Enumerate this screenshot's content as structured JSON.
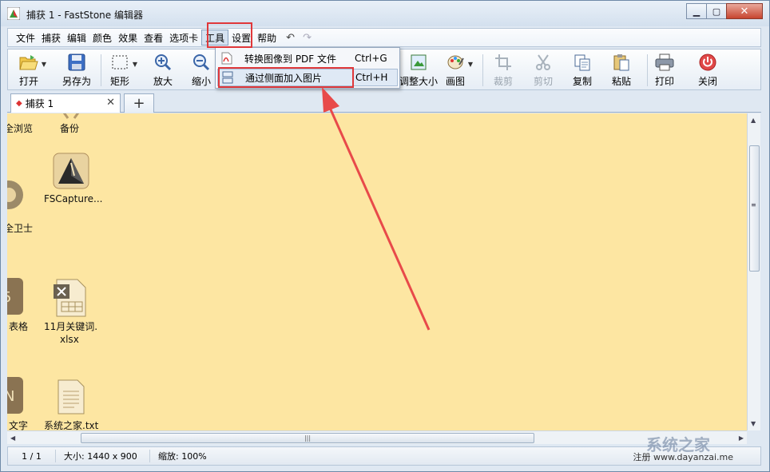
{
  "window": {
    "title": "捕获 1 - FastStone 编辑器",
    "controls": {
      "minimize": "▁",
      "maximize": "▢",
      "close": "✕"
    }
  },
  "menu": {
    "items": [
      "文件",
      "捕获",
      "编辑",
      "颜色",
      "效果",
      "查看",
      "选项卡",
      "工具",
      "设置",
      "帮助"
    ],
    "active": "工具",
    "undo": "↶",
    "redo": "↷"
  },
  "toolbar": {
    "open": "打开",
    "save_as": "另存为",
    "rect": "矩形",
    "zoom_in": "放大",
    "zoom_out": "缩小",
    "resize": "调整大小",
    "draw": "画图",
    "crop": "裁剪",
    "cut": "剪切",
    "copy": "复制",
    "paste": "粘贴",
    "print": "打印",
    "close": "关闭"
  },
  "dropdown": {
    "items": [
      {
        "label": "转换图像到 PDF 文件",
        "shortcut": "Ctrl+G"
      },
      {
        "label": "通过侧面加入图片",
        "shortcut": "Ctrl+H"
      }
    ]
  },
  "tabs": {
    "active_label": "捕获 1",
    "close": "✕",
    "add": "+"
  },
  "desktop": {
    "labels": {
      "browse_partial": "全浏览",
      "backup": "备份",
      "fscapture": "FSCapture...",
      "guard_partial": "全卫士",
      "table_partial": "表格",
      "xlsx_line1": "11月关键词.",
      "xlsx_line2": "xlsx",
      "text_partial": "文字",
      "txt_file": "系统之家.txt"
    }
  },
  "statusbar": {
    "page": "1 / 1",
    "size": "大小: 1440 x 900",
    "zoom": "缩放: 100%",
    "right": "注册 www.dayanzai.me"
  },
  "watermark": "系统之家",
  "colors": {
    "canvas": "#fde6a2",
    "highlight": "#e0383a"
  }
}
